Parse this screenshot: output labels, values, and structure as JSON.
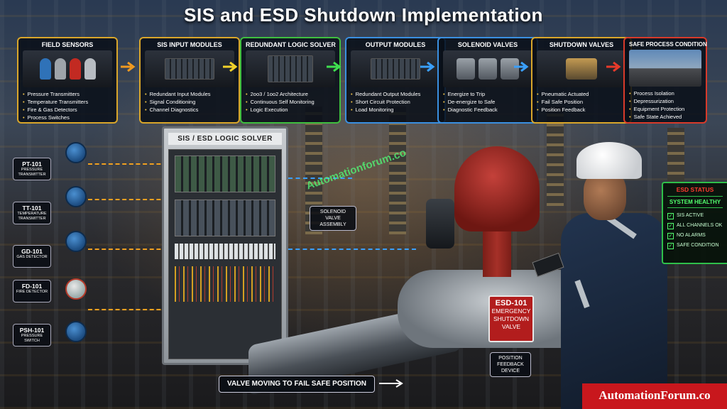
{
  "title": "SIS and ESD Shutdown Implementation",
  "flow": [
    {
      "title": "FIELD SENSORS",
      "border": "#d9a62a",
      "items": [
        "Pressure Transmitters",
        "Temperature Transmitters",
        "Fire & Gas Detectors",
        "Process Switches"
      ]
    },
    {
      "title": "SIS INPUT MODULES",
      "border": "#d9a62a",
      "items": [
        "Redundant Input Modules",
        "Signal Conditioning",
        "Channel Diagnostics"
      ]
    },
    {
      "title": "REDUNDANT LOGIC SOLVER",
      "border": "#3fbf3f",
      "items": [
        "2oo3 / 1oo2 Architecture",
        "Continuous Self Monitoring",
        "Logic Execution"
      ]
    },
    {
      "title": "OUTPUT MODULES",
      "border": "#3a8fe0",
      "items": [
        "Redundant Output Modules",
        "Short Circuit Protection",
        "Load Monitoring"
      ]
    },
    {
      "title": "SOLENOID VALVES",
      "border": "#3a8fe0",
      "items": [
        "Energize to Trip",
        "De-energize to Safe",
        "Diagnostic Feedback"
      ]
    },
    {
      "title": "SHUTDOWN VALVES",
      "border": "#d9a62a",
      "items": [
        "Pneumatic Actuated",
        "Fail Safe Position",
        "Position Feedback"
      ]
    },
    {
      "title": "SAFE PROCESS CONDITION",
      "border": "#d83a2a",
      "items": [
        "Process Isolation",
        "Depressurization",
        "Equipment Protection",
        "Safe State Achieved"
      ]
    }
  ],
  "arrow_colors": [
    "#f09a20",
    "#f2d22a",
    "#3fdf4f",
    "#3aa0ff",
    "#3aa0ff",
    "#3aa0ff",
    "#e83a2a"
  ],
  "cabinet": {
    "label": "SIS / ESD LOGIC SOLVER"
  },
  "field_tags": [
    {
      "id": "PT-101",
      "desc": "PRESSURE TRANSMITTER"
    },
    {
      "id": "TT-101",
      "desc": "TEMPERATURE TRANSMITTER"
    },
    {
      "id": "GD-101",
      "desc": "GAS DETECTOR"
    },
    {
      "id": "FD-101",
      "desc": "FIRE DETECTOR"
    },
    {
      "id": "PSH-101",
      "desc": "PRESSURE SWITCH"
    }
  ],
  "solenoid_callout": "SOLENOID VALVE ASSEMBLY",
  "valve_tag": {
    "id": "ESD-101",
    "desc": "EMERGENCY SHUTDOWN VALVE"
  },
  "position_callout": "POSITION FEEDBACK DEVICE",
  "status_banner": "VALVE MOVING TO FAIL SAFE POSITION",
  "esd_status": {
    "title": "ESD STATUS",
    "health": "SYSTEM HEALTHY",
    "items": [
      "SIS ACTIVE",
      "ALL CHANNELS OK",
      "NO ALARMS",
      "SAFE CONDITION"
    ]
  },
  "watermark_mid": "Automationforum.co",
  "watermark_corner": "AutomationForum.co",
  "colors": {
    "accent_gold": "#d9a62a",
    "signal_orange": "#f0a020",
    "signal_blue": "#3aa0ff",
    "esd_red": "#b21d1d",
    "status_green": "#53ff6e"
  }
}
